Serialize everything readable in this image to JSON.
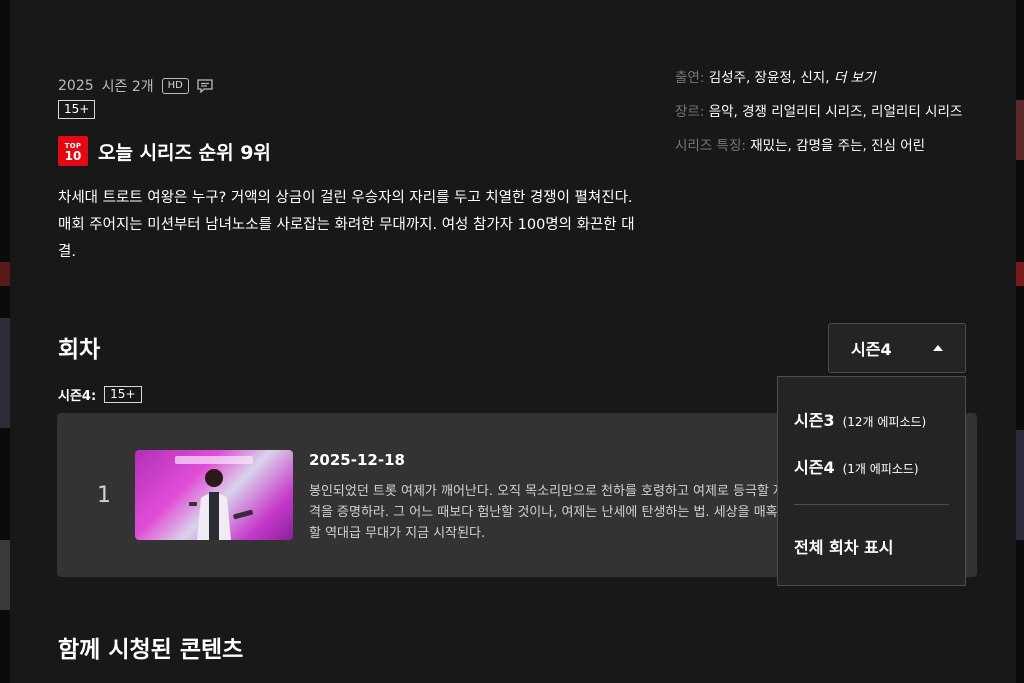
{
  "details": {
    "year": "2025",
    "seasons_count": "시즌 2개",
    "hd_badge": "HD",
    "maturity": "15+",
    "rank_badge_top": "TOP",
    "rank_badge_bottom": "10",
    "rank_text": "오늘 시리즈 순위 9위",
    "description": "차세대 트로트 여왕은 누구? 거액의 상금이 걸린 우승자의 자리를 두고 치열한 경쟁이 펼쳐진다. 매회 주어지는 미션부터 남녀노소를 사로잡는 화려한 무대까지. 여성 참가자 100명의 화끈한 대결."
  },
  "credits": {
    "cast_key": "출연:",
    "cast_value": "김성주, 장윤정, 신지,",
    "cast_more": "더 보기",
    "genre_key": "장르:",
    "genre_value": "음악, 경쟁 리얼리티 시리즈, 리얼리티 시리즈",
    "traits_key": "시리즈 특징:",
    "traits_value": "재밌는, 감명을 주는, 진심 어린"
  },
  "episodes": {
    "section_title": "회차",
    "season_label": "시즌4:",
    "season_rating": "15+",
    "season_selector": "시즌4",
    "list": [
      {
        "number": "1",
        "date": "2025-12-18",
        "description": "봉인되었던 트롯 여제가 깨어난다. 오직 목소리만으로 천하를 호령하고 여제로 등극할 자격을 증명하라. 그 어느 때보다 험난할 것이나, 여제는 난세에 탄생하는 법. 세상을 매혹할 역대급 무대가 지금 시작된다."
      }
    ]
  },
  "dropdown": {
    "items": [
      {
        "name": "시즌3",
        "count": "(12개 에피소드)"
      },
      {
        "name": "시즌4",
        "count": "(1개 에피소드)"
      }
    ],
    "all_label": "전체 회차 표시"
  },
  "more_like_this": {
    "title": "함께 시청된 콘텐츠"
  },
  "colors": {
    "background": "#181818",
    "card": "#333333",
    "brand_red": "#e50914"
  }
}
